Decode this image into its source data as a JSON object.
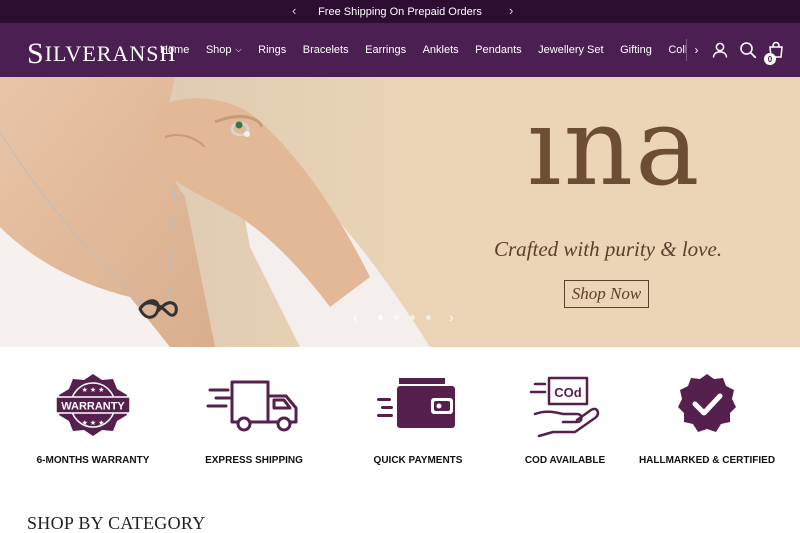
{
  "announcement": {
    "text": "Free Shipping On Prepaid Orders",
    "prev_icon": "‹",
    "next_icon": "›"
  },
  "header": {
    "logo_initial": "S",
    "logo_rest": "ILVERANSH",
    "nav": [
      {
        "label": "Home"
      },
      {
        "label": "Shop",
        "has_dropdown": true
      },
      {
        "label": "Rings"
      },
      {
        "label": "Bracelets"
      },
      {
        "label": "Earrings"
      },
      {
        "label": "Anklets"
      },
      {
        "label": "Pendants"
      },
      {
        "label": "Jewellery Set"
      },
      {
        "label": "Gifting"
      },
      {
        "label": "Collections"
      }
    ],
    "nav_next_icon": "›",
    "dropdown_icon": "⌵",
    "cart_count": "0"
  },
  "hero": {
    "brand": "ına",
    "tagline": "Crafted with purity & love.",
    "cta": "Shop Now",
    "prev_icon": "‹",
    "next_icon": "›",
    "slides": 4,
    "active_slide": 1
  },
  "features": [
    {
      "label": "6-MONTHS WARRANTY",
      "badge_text": "WARRANTY",
      "icon": "warranty-badge-icon"
    },
    {
      "label": "EXPRESS SHIPPING",
      "icon": "delivery-truck-icon"
    },
    {
      "label": "QUICK PAYMENTS",
      "icon": "wallet-icon"
    },
    {
      "label": "COD AVAILABLE",
      "badge_text": "COd",
      "icon": "cod-hand-icon"
    },
    {
      "label": "HALLMARKED & CERTIFIED",
      "icon": "certified-check-icon"
    }
  ],
  "section": {
    "title": "SHOP BY CATEGORY"
  },
  "colors": {
    "primary": "#4b1f52",
    "announcement": "#2e0d33",
    "hero_bg": "#ecd5b6",
    "hero_text": "#6e4d35",
    "feature_icon": "#55204e"
  }
}
